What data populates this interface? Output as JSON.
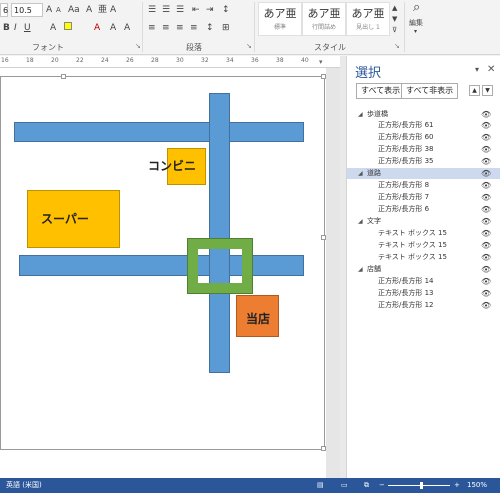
{
  "ribbon": {
    "font_name": "6",
    "font_size": "10.5",
    "font_group": "フォント",
    "paragraph_group": "段落",
    "style_group": "スタイル",
    "edit_label": "編集",
    "styles": [
      {
        "big": "あア亜",
        "small": "標準"
      },
      {
        "big": "あア亜",
        "small": "行間詰め"
      },
      {
        "big": "あア亜",
        "small": "見出し 1"
      }
    ],
    "font_color_icon": "font-color-icon",
    "highlight_icon": "highlight-icon"
  },
  "ruler": {
    "numbers": [
      "16",
      "18",
      "20",
      "22",
      "24",
      "26",
      "28",
      "30",
      "32",
      "34",
      "36",
      "38",
      "40"
    ]
  },
  "canvas": {
    "konbini": "コンビニ",
    "super": "スーパー",
    "touten": "当店",
    "colors": {
      "road": "#5b9bd5",
      "yellow": "#ffc000",
      "orange": "#ed7d31",
      "green": "#70ad47"
    }
  },
  "selection_pane": {
    "title": "選択",
    "show_all": "すべて表示",
    "hide_all": "すべて非表示",
    "groups": [
      {
        "name": "歩道橋",
        "items": [
          "正方形/長方形 61",
          "正方形/長方形 60",
          "正方形/長方形 38",
          "正方形/長方形 35"
        ]
      },
      {
        "name": "道路",
        "items": [
          "正方形/長方形 8",
          "正方形/長方形 7",
          "正方形/長方形 6"
        ]
      },
      {
        "name": "文字",
        "items": [
          "テキスト ボックス 15",
          "テキスト ボックス 15",
          "テキスト ボックス 15"
        ]
      },
      {
        "name": "店舗",
        "items": [
          "正方形/長方形 14",
          "正方形/長方形 13",
          "正方形/長方形 12"
        ]
      }
    ]
  },
  "status": {
    "language": "英語 (米国)",
    "zoom": "150%"
  }
}
